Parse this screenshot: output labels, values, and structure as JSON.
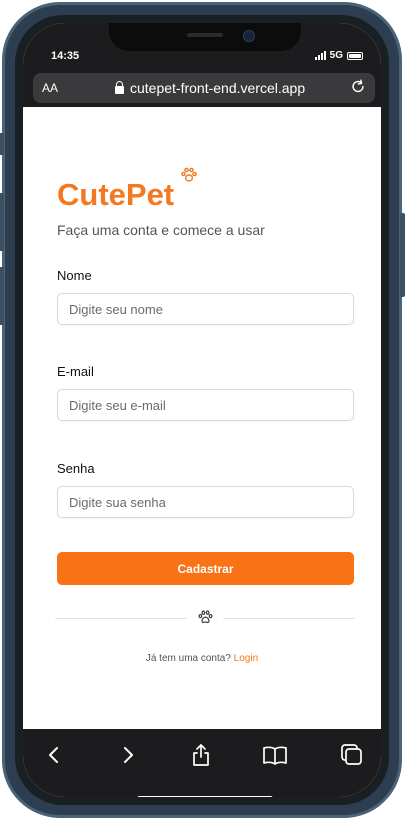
{
  "status_bar": {
    "time": "14:35",
    "network": "5G",
    "icons": [
      "signal-icon",
      "battery-icon"
    ]
  },
  "browser": {
    "text_size_label": "AA",
    "url": "cutepet-front-end.vercel.app",
    "icons": [
      "lock-icon",
      "reload-icon"
    ]
  },
  "brand": {
    "name": "CutePet",
    "accent_color": "#f47820",
    "icon": "paw-icon"
  },
  "form": {
    "subtitle": "Faça uma conta e comece a usar",
    "name_label": "Nome",
    "name_placeholder": "Digite seu nome",
    "name_value": "",
    "email_label": "E-mail",
    "email_placeholder": "Digite seu e-mail",
    "email_value": "",
    "password_label": "Senha",
    "password_placeholder": "Digite sua senha",
    "password_value": "",
    "submit_label": "Cadastrar",
    "submit_color": "#f97316"
  },
  "footer": {
    "prompt": "Já tem uma conta?",
    "login_link": "Login"
  },
  "toolbar": {
    "icons": [
      "back-icon",
      "forward-icon",
      "share-icon",
      "bookmarks-icon",
      "tabs-icon"
    ]
  }
}
